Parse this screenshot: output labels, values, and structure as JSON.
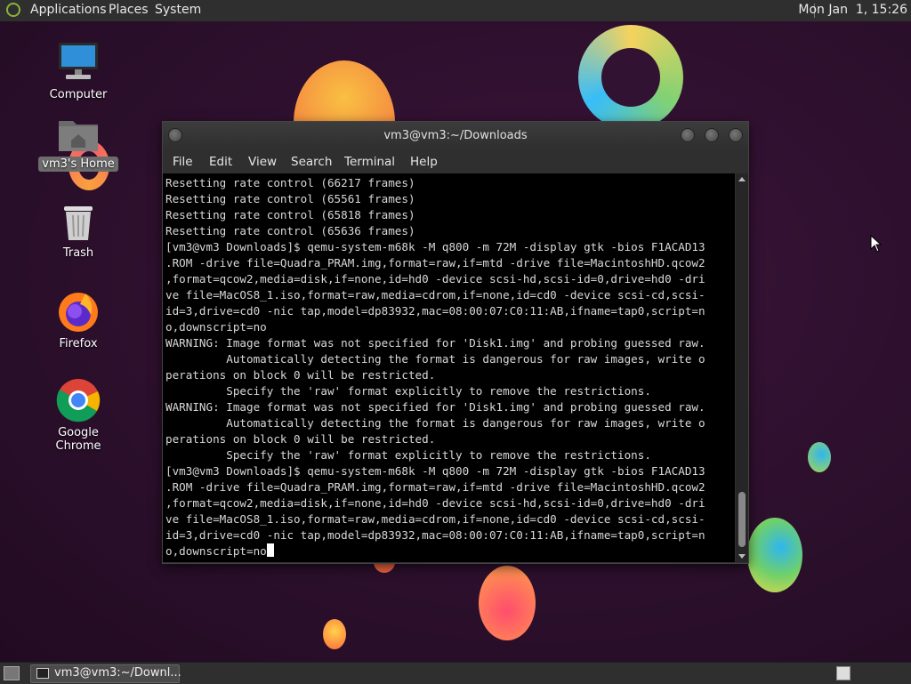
{
  "top_panel": {
    "menus": [
      "Applications",
      "Places",
      "System"
    ],
    "clock": "Mon Jan  1, 15:26"
  },
  "desktop_icons": [
    {
      "label": "Computer",
      "icon": "computer-icon"
    },
    {
      "label": "vm3's Home",
      "icon": "home-folder-icon"
    },
    {
      "label": "Trash",
      "icon": "trash-icon"
    },
    {
      "label": "Firefox",
      "icon": "firefox-icon"
    },
    {
      "label": "Google Chrome",
      "icon": "chrome-icon"
    }
  ],
  "terminal": {
    "title": "vm3@vm3:~/Downloads",
    "menu": [
      "File",
      "Edit",
      "View",
      "Search",
      "Terminal",
      "Help"
    ],
    "lines": [
      "Resetting rate control (66217 frames)",
      "Resetting rate control (65561 frames)",
      "Resetting rate control (65818 frames)",
      "Resetting rate control (65636 frames)",
      "[vm3@vm3 Downloads]$ qemu-system-m68k -M q800 -m 72M -display gtk -bios F1ACAD13",
      ".ROM -drive file=Quadra_PRAM.img,format=raw,if=mtd -drive file=MacintoshHD.qcow2",
      ",format=qcow2,media=disk,if=none,id=hd0 -device scsi-hd,scsi-id=0,drive=hd0 -dri",
      "ve file=MacOS8_1.iso,format=raw,media=cdrom,if=none,id=cd0 -device scsi-cd,scsi-",
      "id=3,drive=cd0 -nic tap,model=dp83932,mac=08:00:07:C0:11:AB,ifname=tap0,script=n",
      "o,downscript=no",
      "WARNING: Image format was not specified for 'Disk1.img' and probing guessed raw.",
      "         Automatically detecting the format is dangerous for raw images, write o",
      "perations on block 0 will be restricted.",
      "         Specify the 'raw' format explicitly to remove the restrictions.",
      "WARNING: Image format was not specified for 'Disk1.img' and probing guessed raw.",
      "         Automatically detecting the format is dangerous for raw images, write o",
      "perations on block 0 will be restricted.",
      "         Specify the 'raw' format explicitly to remove the restrictions.",
      "[vm3@vm3 Downloads]$ qemu-system-m68k -M q800 -m 72M -display gtk -bios F1ACAD13",
      ".ROM -drive file=Quadra_PRAM.img,format=raw,if=mtd -drive file=MacintoshHD.qcow2",
      ",format=qcow2,media=disk,if=none,id=hd0 -device scsi-hd,scsi-id=0,drive=hd0 -dri",
      "ve file=MacOS8_1.iso,format=raw,media=cdrom,if=none,id=cd0 -device scsi-cd,scsi-",
      "id=3,drive=cd0 -nic tap,model=dp83932,mac=08:00:07:C0:11:AB,ifname=tap0,script=n",
      "o,downscript=no"
    ]
  },
  "taskbar": {
    "task_label": "vm3@vm3:~/Downl..."
  }
}
